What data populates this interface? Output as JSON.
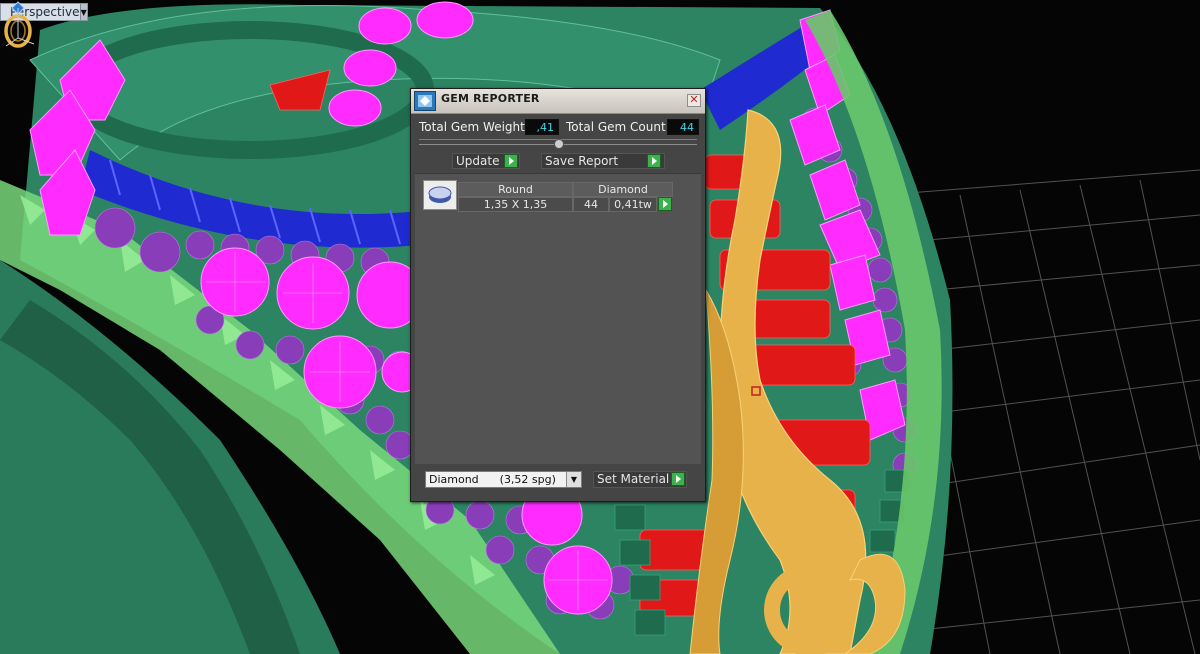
{
  "viewport": {
    "label": "Perspective",
    "menu_glyph": "▼"
  },
  "panel": {
    "title": "GEM REPORTER",
    "close_glyph": "✕",
    "total_weight_label": "Total Gem Weight",
    "total_weight_value": ",41",
    "total_count_label": "Total Gem Count",
    "total_count_value": "44",
    "update_label": "Update",
    "save_report_label": "Save Report",
    "gems": [
      {
        "cut": "Round",
        "material": "Diamond",
        "size": "1,35 X 1,35",
        "count": "44",
        "weight": "0,41tw"
      }
    ],
    "material_select": "Diamond      (3,52 spg)",
    "set_material_label": "Set Material"
  },
  "colors": {
    "ring_green": "#2f8a66",
    "prong_green": "#7fe07f",
    "gem_magenta": "#ff2bff",
    "rope_blue": "#1f2bd0",
    "bead_purple": "#8a3db8",
    "rod_red": "#e01818",
    "gold": "#e8b24a",
    "panel_gray": "#454545",
    "lcd_cyan": "#3fd8e8",
    "button_green": "#3bb24b"
  },
  "icons": [
    "viewport-menu-icon",
    "ring-navigator-icon",
    "axis-triad-icon",
    "gem-reporter-app-icon",
    "close-icon",
    "play-icon",
    "round-gem-icon",
    "dropdown-arrow-icon"
  ]
}
